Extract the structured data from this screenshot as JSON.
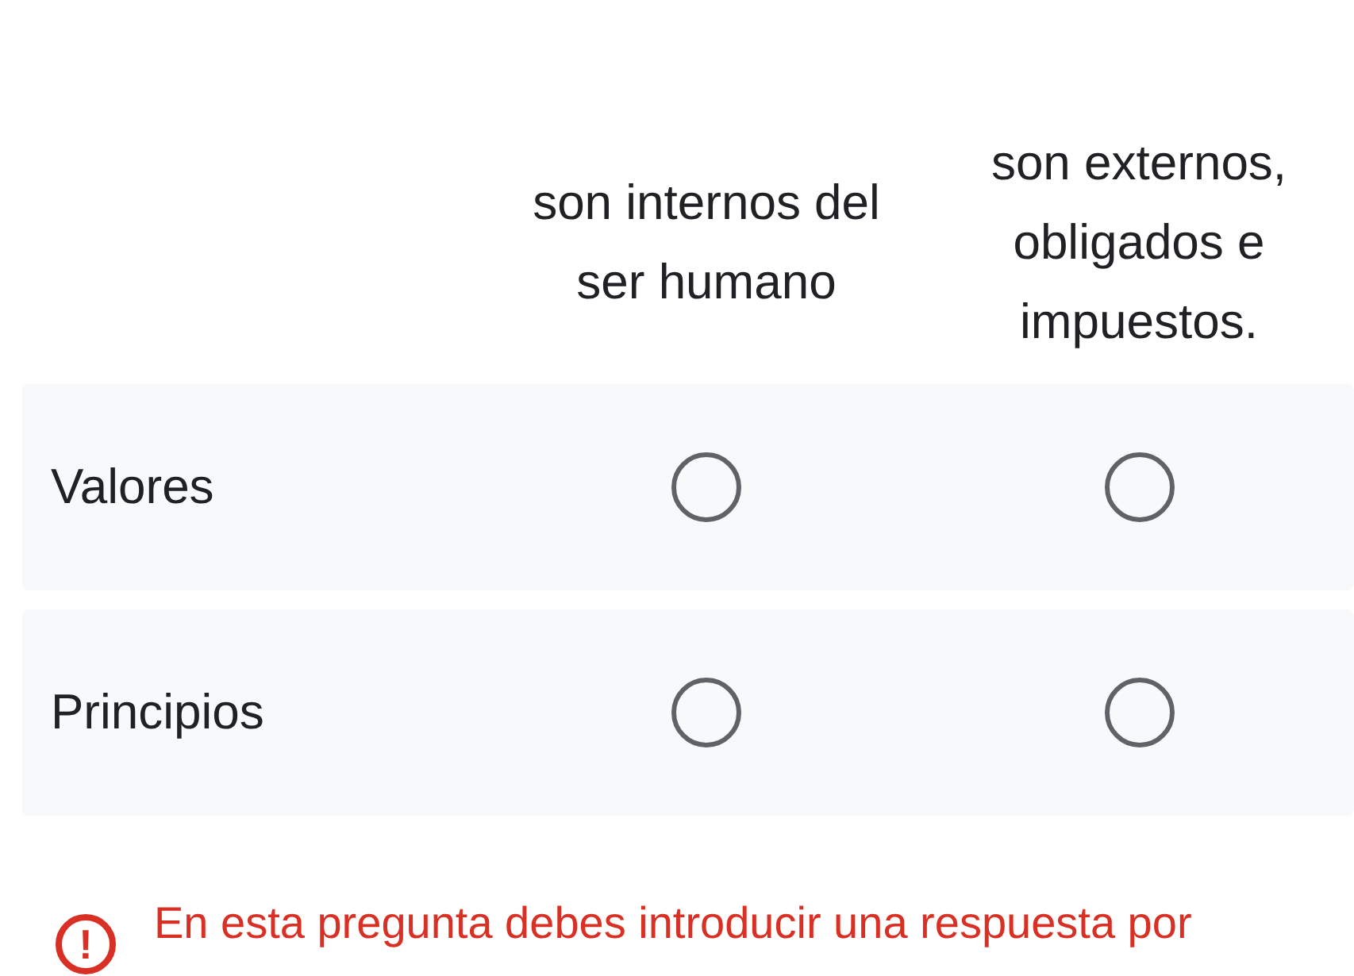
{
  "columns": [
    "son internos del ser humano",
    "son externos, obligados e impuestos."
  ],
  "rows": [
    {
      "label": "Valores",
      "choices": [
        {
          "selected": false
        },
        {
          "selected": false
        }
      ]
    },
    {
      "label": "Principios",
      "choices": [
        {
          "selected": false
        },
        {
          "selected": false
        }
      ]
    }
  ],
  "error": {
    "icon": "!",
    "message": "En esta pregunta debes introducir una respuesta por"
  }
}
